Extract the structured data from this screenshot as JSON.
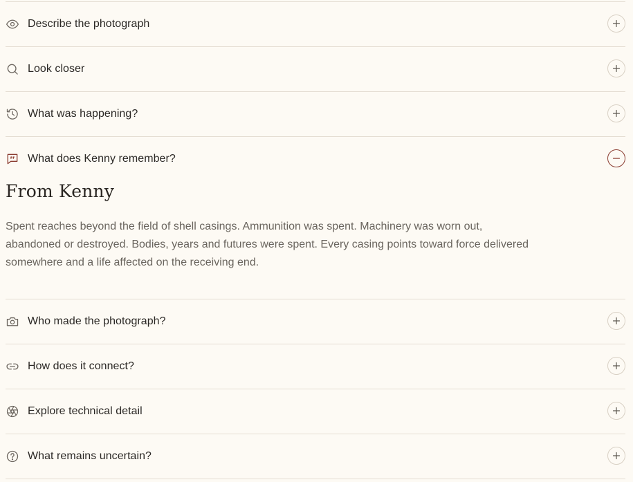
{
  "accordion": {
    "items": [
      {
        "label": "Describe the photograph",
        "icon": "eye-icon",
        "state": "collapsed"
      },
      {
        "label": "Look closer",
        "icon": "search-icon",
        "state": "collapsed"
      },
      {
        "label": "What was happening?",
        "icon": "history-icon",
        "state": "collapsed"
      },
      {
        "label": "What does Kenny remember?",
        "icon": "quote-message-icon",
        "state": "expanded"
      },
      {
        "label": "Who made the photograph?",
        "icon": "camera-icon",
        "state": "collapsed"
      },
      {
        "label": "How does it connect?",
        "icon": "link-icon",
        "state": "collapsed"
      },
      {
        "label": "Explore technical detail",
        "icon": "aperture-icon",
        "state": "collapsed"
      },
      {
        "label": "What remains uncertain?",
        "icon": "help-circle-icon",
        "state": "collapsed"
      }
    ],
    "expanded_panel": {
      "heading": "From Kenny",
      "body": "Spent reaches beyond the field of shell casings. Ammunition was spent. Machinery was worn out, abandoned or destroyed. Bodies, years and futures were spent. Every casing points toward force delivered somewhere and a life affected on the receiving end."
    }
  },
  "colors": {
    "background": "#fdfaf4",
    "divider": "#e4ddd2",
    "accent": "#8a3b2f",
    "text": "#2b2825",
    "muted": "#6a655e"
  }
}
